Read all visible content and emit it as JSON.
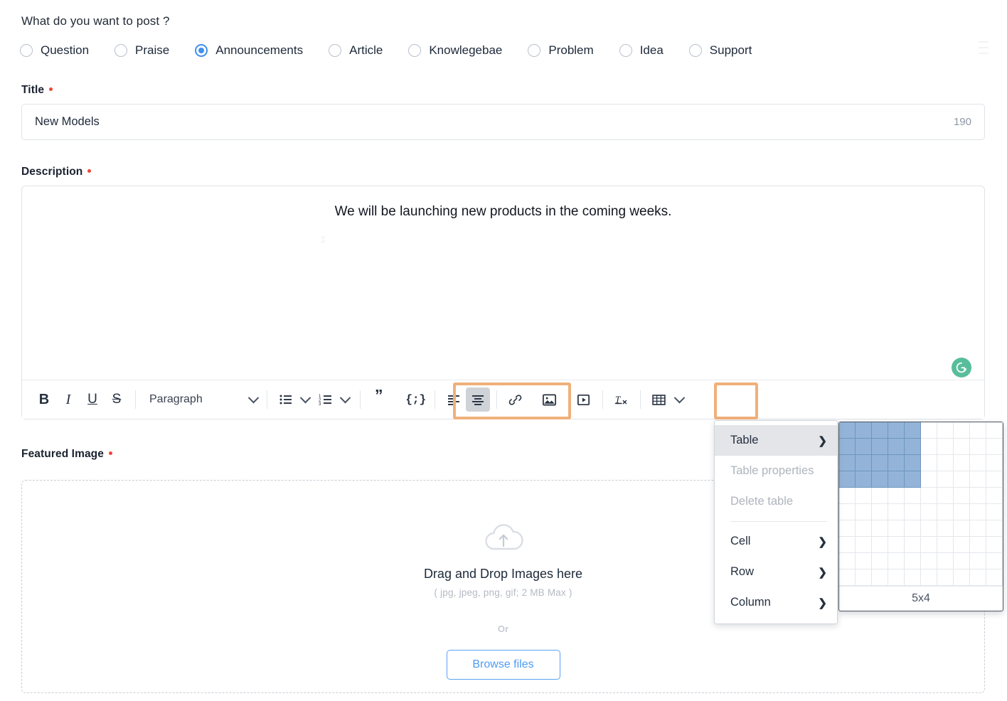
{
  "form": {
    "post_question": "What do you want to post ?",
    "post_types": [
      {
        "label": "Question",
        "selected": false
      },
      {
        "label": "Praise",
        "selected": false
      },
      {
        "label": "Announcements",
        "selected": true
      },
      {
        "label": "Article",
        "selected": false
      },
      {
        "label": "Knowlegebae",
        "selected": false
      },
      {
        "label": "Problem",
        "selected": false
      },
      {
        "label": "Idea",
        "selected": false
      },
      {
        "label": "Support",
        "selected": false
      }
    ],
    "title": {
      "label": "Title",
      "value": "New Models",
      "char_count": "190"
    },
    "description": {
      "label": "Description",
      "value": "We will be launching new products in the coming weeks."
    },
    "featured_image": {
      "label": "Featured Image",
      "drop_title": "Drag and Drop Images here",
      "drop_hint": "( jpg, jpeg, png, gif; 2 MB Max )",
      "or_text": "Or",
      "browse_label": "Browse files"
    }
  },
  "toolbar": {
    "bold": "B",
    "italic": "I",
    "underline": "U",
    "strike": "S",
    "paragraph_label": "Paragraph",
    "quote": "”",
    "code": "{;}",
    "icons": {
      "bullet_list": "bullet-list-icon",
      "numbered_list": "numbered-list-icon",
      "align_left": "align-left-icon",
      "align_center": "align-center-icon",
      "link": "link-icon",
      "image": "image-icon",
      "video": "video-icon",
      "clear_format": "clear-formatting-icon",
      "table": "table-icon"
    }
  },
  "table_menu": {
    "items": [
      {
        "label": "Table",
        "submenu": true,
        "disabled": false,
        "hover": true
      },
      {
        "label": "Table properties",
        "submenu": false,
        "disabled": true,
        "hover": false
      },
      {
        "label": "Delete table",
        "submenu": false,
        "disabled": true,
        "hover": false
      },
      {
        "label": "Cell",
        "submenu": true,
        "disabled": false,
        "hover": false
      },
      {
        "label": "Row",
        "submenu": true,
        "disabled": false,
        "hover": false
      },
      {
        "label": "Column",
        "submenu": true,
        "disabled": false,
        "hover": false
      }
    ],
    "arrow_glyph": "›"
  },
  "grid_picker": {
    "columns": 10,
    "rows": 10,
    "selected_columns": 5,
    "selected_rows": 4,
    "size_label": "5x4",
    "selected_color": "#93b4d8"
  },
  "colors": {
    "accent_blue": "#3f90ef",
    "required_red": "#f0453a",
    "highlight_orange": "#f0b07a",
    "grammarly_green": "#58bd9b",
    "link_blue": "#4d9bf3"
  },
  "grammarly_badge": "G"
}
